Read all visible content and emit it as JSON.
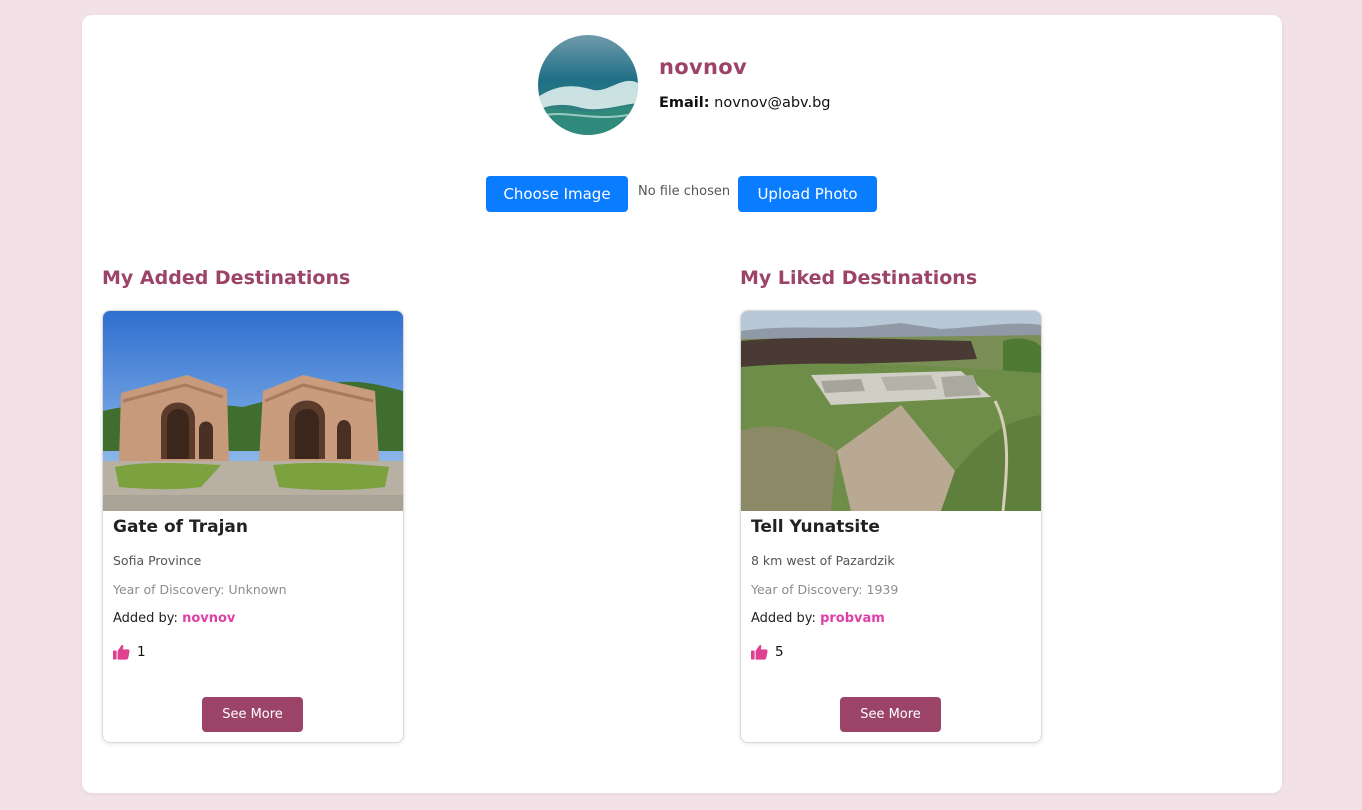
{
  "profile": {
    "username": "novnov",
    "email_label": "Email:",
    "email": "novnov@abv.bg",
    "avatar_alt": "profile photo"
  },
  "upload": {
    "choose_label": "Choose Image",
    "no_file_text": "No file chosen",
    "upload_label": "Upload Photo"
  },
  "sections": {
    "added_title": "My Added Destinations",
    "liked_title": "My Liked Destinations"
  },
  "added": [
    {
      "title": "Gate of Trajan",
      "location": "Sofia Province",
      "year_label": "Year of Discovery:",
      "year": "Unknown",
      "added_by_label": "Added by:",
      "added_by": "novnov",
      "likes": "1",
      "button": "See More"
    }
  ],
  "liked": [
    {
      "title": "Tell Yunatsite",
      "location": "8 km west of Pazardzik",
      "year_label": "Year of Discovery:",
      "year": "1939",
      "added_by_label": "Added by:",
      "added_by": "probvam",
      "likes": "5",
      "button": "See More"
    }
  ],
  "colors": {
    "page_bg": "#f3e1e8",
    "accent": "#9b4468",
    "link": "#e03fa8",
    "primary_button": "#0a7cff",
    "like_icon": "#e04090"
  },
  "icons": {
    "like": "thumbs-up-icon"
  }
}
